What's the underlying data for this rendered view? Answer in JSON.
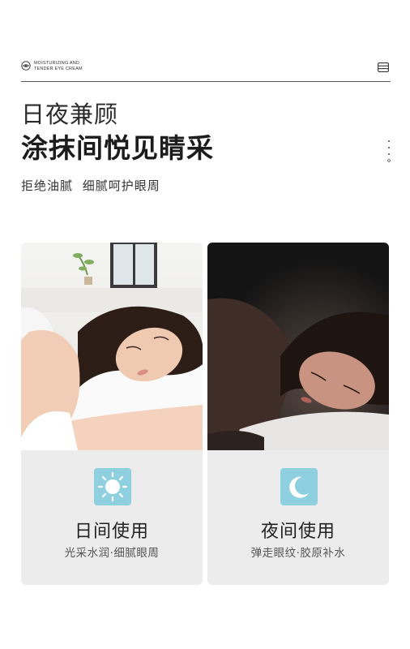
{
  "header": {
    "brand_line1": "MOISTURIZING AND",
    "brand_line2": "TENDER EYE CREAM",
    "brand_icon": "eye-icon",
    "menu_icon": "menu-icon"
  },
  "headline": {
    "title_line1": "日夜兼顾",
    "title_line2": "涂抹间悦见睛采",
    "subtitle": "拒绝油腻 细腻呵护眼周"
  },
  "cards": [
    {
      "id": "day",
      "photo": "woman-sleeping-daylight",
      "icon": "sun-icon",
      "icon_color": "#8fd0e0",
      "title": "日间使用",
      "subtitle": "光采水润·细腻眼周"
    },
    {
      "id": "night",
      "photo": "woman-sleeping-night",
      "icon": "moon-icon",
      "icon_color": "#8fd0e0",
      "title": "夜间使用",
      "subtitle": "弹走眼纹·胶原补水"
    }
  ]
}
